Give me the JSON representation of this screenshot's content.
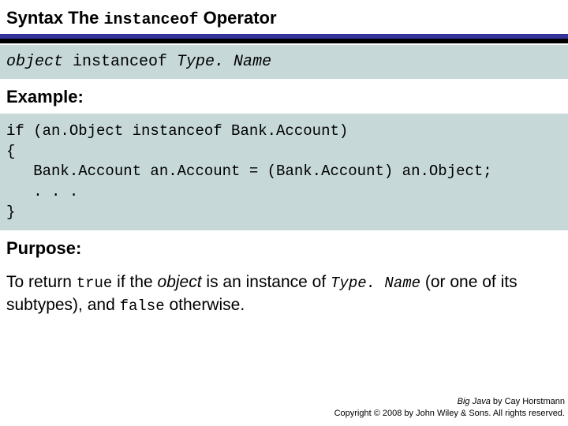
{
  "title_prefix": "Syntax The ",
  "title_operator": "instanceof",
  "title_suffix": " Operator",
  "syntax_object": "object",
  "syntax_keyword": " instanceof ",
  "syntax_typename": "Type. Name",
  "example_label": "Example:",
  "example_code": "if (an.Object instanceof Bank.Account)\n{\n   Bank.Account an.Account = (Bank.Account) an.Object;\n   . . .\n}",
  "purpose_label": "Purpose:",
  "purpose": {
    "p1": "To return ",
    "true": "true",
    "p2": " if the ",
    "object": "object",
    "p3": " is an instance of ",
    "typename": "Type. Name",
    "p4": " (or one of its subtypes), and ",
    "false": "false",
    "p5": " otherwise."
  },
  "footer": {
    "book": "Big Java",
    "author": " by Cay Horstmann",
    "copyright": "Copyright © 2008 by John Wiley & Sons. All rights reserved."
  }
}
